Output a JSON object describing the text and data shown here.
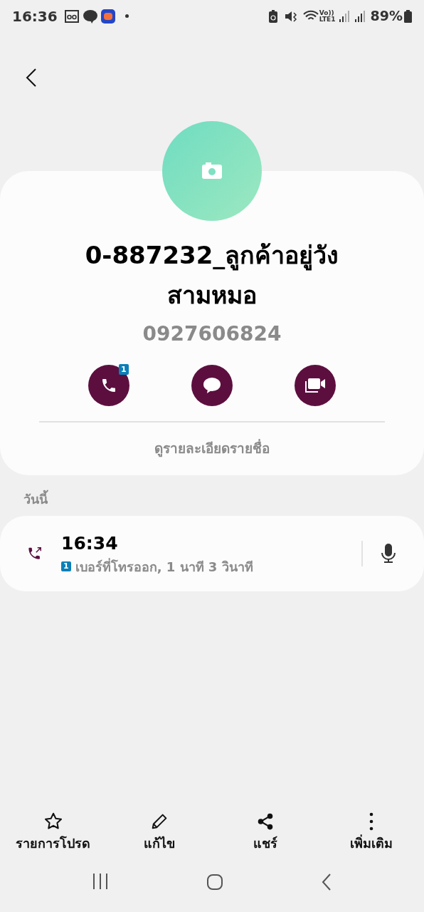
{
  "status_bar": {
    "time": "16:36",
    "volte": "Vo))",
    "network": "LTE1",
    "battery": "89%"
  },
  "contact": {
    "name": "0-887232_ลูกค้าอยู่วังสามหมอ",
    "number": "0927606824",
    "call_badge": "1",
    "details_link": "ดูรายละเอียดรายชื่อ"
  },
  "section_title": "วันนี้",
  "call_log": [
    {
      "time": "16:34",
      "sim": "1",
      "description": "เบอร์ที่โทรออก, 1 นาที 3 วินาที"
    }
  ],
  "bottom_actions": [
    {
      "kind": "star",
      "label": "รายการโปรด"
    },
    {
      "kind": "edit",
      "label": "แก้ไข"
    },
    {
      "kind": "share",
      "label": "แชร์"
    },
    {
      "kind": "more",
      "label": "เพิ่มเติม"
    }
  ]
}
